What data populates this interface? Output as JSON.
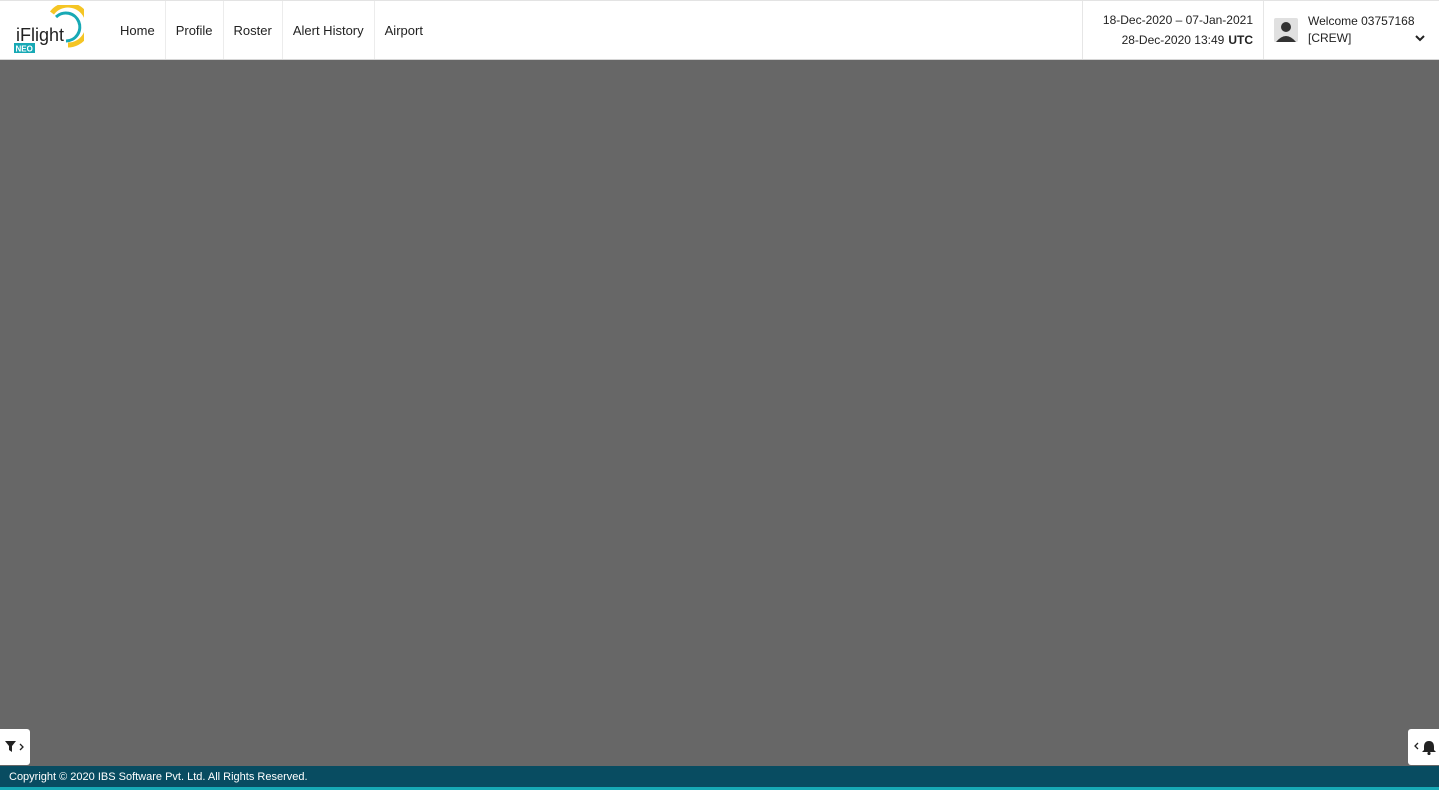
{
  "app": {
    "logo_alt": "iFlight NEO",
    "logo_text": "iFlight",
    "logo_sub": "NEO"
  },
  "nav": [
    {
      "label": "Home"
    },
    {
      "label": "Profile"
    },
    {
      "label": "Roster"
    },
    {
      "label": "Alert History"
    },
    {
      "label": "Airport"
    }
  ],
  "date": {
    "range": "18-Dec-2020 – 07-Jan-2021",
    "now": "28-Dec-2020 13:49",
    "tz": "UTC"
  },
  "user": {
    "welcome": "Welcome 03757168",
    "role": "[CREW]"
  },
  "icons": {
    "avatar": "user-avatar-icon",
    "dropdown": "chevron-down-icon",
    "filter": "filter-icon",
    "bell": "bell-icon"
  },
  "colors": {
    "main_bg": "#676767",
    "footer_bg": "#084c61",
    "footer_accent": "#17a9b5",
    "logo_yellow": "#f5c524",
    "logo_teal": "#17a9b5"
  },
  "footer": {
    "copyright": "Copyright © 2020 IBS Software Pvt. Ltd. All Rights Reserved."
  }
}
